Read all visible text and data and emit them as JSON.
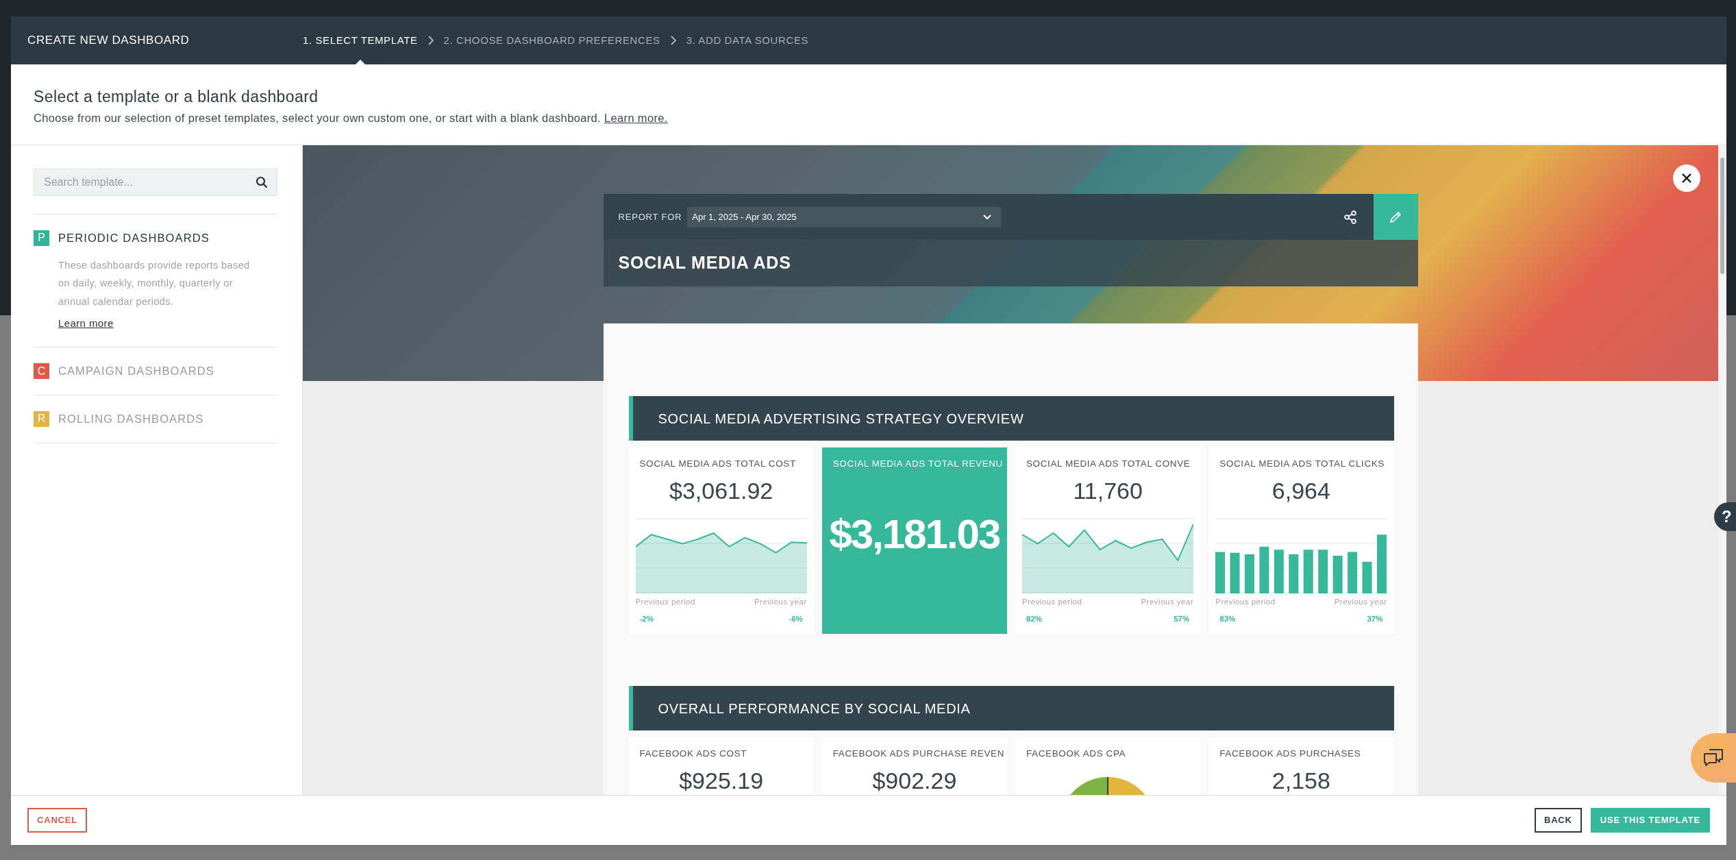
{
  "dialog": {
    "title": "CREATE NEW DASHBOARD",
    "steps": [
      {
        "label": "1. SELECT TEMPLATE",
        "selected": true
      },
      {
        "label": "2. CHOOSE DASHBOARD PREFERENCES",
        "selected": false
      },
      {
        "label": "3. ADD DATA SOURCES",
        "selected": false
      }
    ]
  },
  "intro": {
    "heading": "Select a template or a blank dashboard",
    "text": "Choose from our selection of preset templates, select your own custom one, or start with a blank dashboard.",
    "link": "Learn more."
  },
  "sidebar": {
    "search": {
      "placeholder": "Search template..."
    },
    "categories": [
      {
        "letter": "P",
        "label": "PERIODIC DASHBOARDS",
        "color": "#2fb597",
        "selected": true,
        "description": "These dashboards provide reports based on daily, weekly, monthly, quarterly or annual calendar periods.",
        "link": "Learn more"
      },
      {
        "letter": "C",
        "label": "CAMPAIGN DASHBOARDS",
        "color": "#e05a47",
        "selected": false
      },
      {
        "letter": "R",
        "label": "ROLLING DASHBOARDS",
        "color": "#e3b53c",
        "selected": false
      }
    ]
  },
  "preview": {
    "report_for_label": "REPORT FOR",
    "date_range": "Apr 1, 2025 - Apr 30, 2025",
    "title": "SOCIAL MEDIA ADS",
    "sections": [
      {
        "title": "SOCIAL MEDIA ADVERTISING STRATEGY OVERVIEW",
        "widgets": [
          {
            "kind": "area",
            "title": "SOCIAL MEDIA ADS TOTAL COST",
            "value": "$3,061.92",
            "previous_period_label": "Previous period",
            "previous_period": "-2%",
            "previous_year_label": "Previous year",
            "previous_year": "-6%"
          },
          {
            "kind": "highlight",
            "title": "SOCIAL MEDIA ADS TOTAL REVENU",
            "value": "$3,181.03"
          },
          {
            "kind": "area",
            "title": "SOCIAL MEDIA ADS TOTAL CONVE",
            "value": "11,760",
            "previous_period_label": "Previous period",
            "previous_period": "82%",
            "previous_year_label": "Previous year",
            "previous_year": "57%"
          },
          {
            "kind": "bars",
            "title": "SOCIAL MEDIA ADS TOTAL CLICKS",
            "value": "6,964",
            "previous_period_label": "Previous period",
            "previous_period": "83%",
            "previous_year_label": "Previous year",
            "previous_year": "37%"
          }
        ]
      },
      {
        "title": "OVERALL PERFORMANCE BY SOCIAL MEDIA",
        "widgets": [
          {
            "kind": "value",
            "title": "FACEBOOK ADS COST",
            "value": "$925.19"
          },
          {
            "kind": "value",
            "title": "FACEBOOK ADS PURCHASE REVEN",
            "value": "$902.29"
          },
          {
            "kind": "donut",
            "title": "FACEBOOK ADS CPA"
          },
          {
            "kind": "value",
            "title": "FACEBOOK ADS PURCHASES",
            "value": "2,158"
          }
        ]
      }
    ]
  },
  "footer": {
    "cancel": "CANCEL",
    "back": "BACK",
    "confirm": "USE THIS TEMPLATE"
  },
  "help": {
    "label": "?"
  }
}
